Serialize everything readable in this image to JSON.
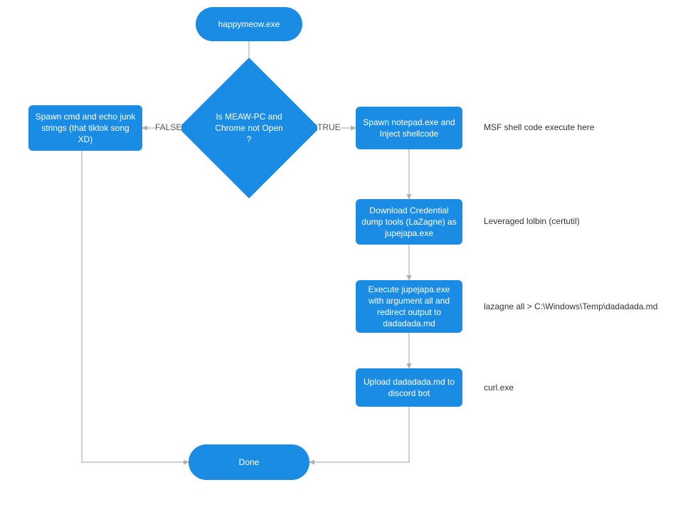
{
  "nodes": {
    "start": "happymeow.exe",
    "decision": "Is MEAW-PC and Chrome not Open ?",
    "false_branch": "Spawn cmd and echo junk strings (that tiktok song XD)",
    "step1": "Spawn notepad.exe and Inject shellcode",
    "step2": "Download Credential dump tools (LaZagne) as jupejapa.exe",
    "step3": "Execute jupejapa.exe with argument all and redirect output to dadadada.md",
    "step4": "Upload dadadada.md to discord bot",
    "end": "Done"
  },
  "edges": {
    "false": "FALSE",
    "true": "TRUE"
  },
  "annotations": {
    "a1": "MSF shell code execute here",
    "a2": "Leveraged lolbin (certutil)",
    "a3": "lazagne all > C:\\Windows\\Temp\\dadadada.md",
    "a4": "curl.exe"
  },
  "colors": {
    "node": "#1b8ce3",
    "connector": "#b0b0b0"
  }
}
